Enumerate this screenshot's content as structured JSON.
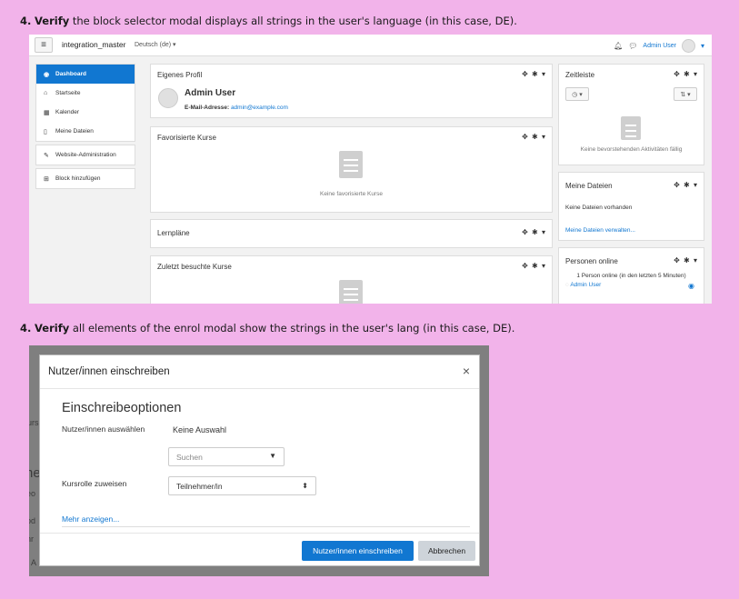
{
  "step1": {
    "num": "4.",
    "verb": "Verify",
    "text": " the  block selector modal displays all strings in the user's language (in this case, DE)."
  },
  "step2": {
    "num": "4.",
    "verb": "Verify",
    "text": " all elements of the  enrol modal show the  strings in the user's lang (in this case, DE)."
  },
  "navbar": {
    "site_name": "integration_master",
    "language": "Deutsch (de) ▾",
    "user_name": "Admin User"
  },
  "sidebar": {
    "items": [
      {
        "label": "Dashboard",
        "icon": "tachometer-icon",
        "glyph": "◉"
      },
      {
        "label": "Startseite",
        "icon": "home-icon",
        "glyph": "⌂"
      },
      {
        "label": "Kalender",
        "icon": "calendar-icon",
        "glyph": "▦"
      },
      {
        "label": "Meine Dateien",
        "icon": "file-icon",
        "glyph": "▯"
      }
    ],
    "admin": {
      "label": "Website-Administration",
      "icon": "wrench-icon",
      "glyph": "✎"
    },
    "add_block": {
      "label": "Block hinzufügen",
      "icon": "plus-square-icon",
      "glyph": "⊞"
    }
  },
  "cards": {
    "profile": {
      "title": "Eigenes Profil",
      "name": "Admin User",
      "email_label": "E-Mail-Adresse:",
      "email": "admin@example.com"
    },
    "favourites": {
      "title": "Favorisierte Kurse",
      "empty": "Keine favorisierte Kurse"
    },
    "plans": {
      "title": "Lernpläne"
    },
    "recent": {
      "title": "Zuletzt besuchte Kurse"
    },
    "timeline": {
      "title": "Zeitleiste",
      "empty": "Keine bevorstehenden Aktivitäten fällig"
    },
    "files": {
      "title": "Meine Dateien",
      "empty": "Keine Dateien vorhanden",
      "manage": "Meine Dateien verwalten..."
    },
    "online": {
      "title": "Personen online",
      "summary": "1 Person online (in den letzten 5 Minuten)",
      "user": "Admin User"
    },
    "controls": "✥ ✱ ▾"
  },
  "modal": {
    "title": "Nutzer/innen einschreiben",
    "close": "×",
    "section": "Einschreibeoptionen",
    "select_users_label": "Nutzer/innen auswählen",
    "select_users_value": "Keine Auswahl",
    "search_placeholder": "Suchen",
    "role_label": "Kursrolle zuweisen",
    "role_value": "Teilnehmer/in",
    "more": "Mehr anzeigen...",
    "submit": "Nutzer/innen einschreiben",
    "cancel": "Abbrechen"
  },
  "background_fragments": [
    "urs",
    "ne",
    "eo",
    "od",
    "hr",
    "A"
  ],
  "colors": {
    "page_bg": "#f2b3ea",
    "accent": "#1177d1",
    "overlay": "#7f7f7f"
  }
}
